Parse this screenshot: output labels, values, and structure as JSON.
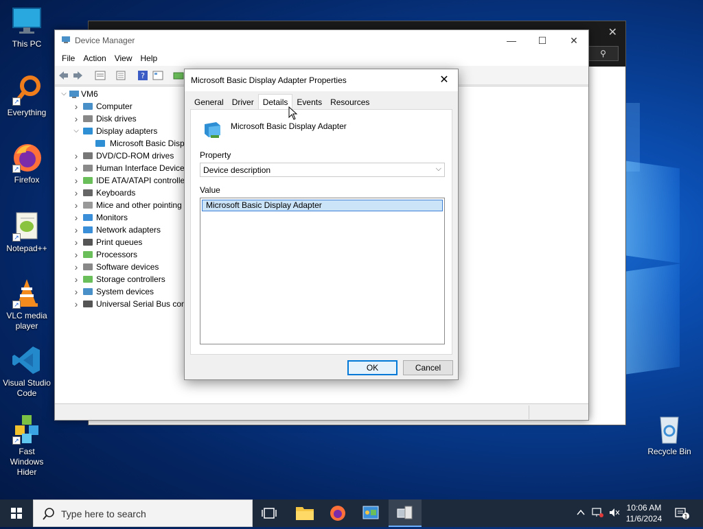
{
  "desktop": {
    "icons": [
      {
        "label": "This PC"
      },
      {
        "label": "Everything"
      },
      {
        "label": "Firefox"
      },
      {
        "label": "Notepad++"
      },
      {
        "label": "VLC media player"
      },
      {
        "label": "Visual Studio Code"
      },
      {
        "label": "Fast Windows Hider"
      }
    ],
    "recycle_bin": "Recycle Bin"
  },
  "device_manager": {
    "title": "Device Manager",
    "menu": [
      "File",
      "Action",
      "View",
      "Help"
    ],
    "tree": {
      "root": "VM6",
      "nodes": [
        {
          "label": "Computer",
          "expanded": false
        },
        {
          "label": "Disk drives",
          "expanded": false
        },
        {
          "label": "Display adapters",
          "expanded": true
        },
        {
          "label": "Microsoft Basic Disp",
          "child": true
        },
        {
          "label": "DVD/CD-ROM drives",
          "expanded": false
        },
        {
          "label": "Human Interface Device",
          "expanded": false
        },
        {
          "label": "IDE ATA/ATAPI controlle",
          "expanded": false
        },
        {
          "label": "Keyboards",
          "expanded": false
        },
        {
          "label": "Mice and other pointing",
          "expanded": false
        },
        {
          "label": "Monitors",
          "expanded": false
        },
        {
          "label": "Network adapters",
          "expanded": false
        },
        {
          "label": "Print queues",
          "expanded": false
        },
        {
          "label": "Processors",
          "expanded": false
        },
        {
          "label": "Software devices",
          "expanded": false
        },
        {
          "label": "Storage controllers",
          "expanded": false
        },
        {
          "label": "System devices",
          "expanded": false
        },
        {
          "label": "Universal Serial Bus cont",
          "expanded": false
        }
      ]
    }
  },
  "dialog": {
    "title": "Microsoft Basic Display Adapter Properties",
    "close_glyph": "✕",
    "tabs": [
      "General",
      "Driver",
      "Details",
      "Events",
      "Resources"
    ],
    "active_tab": "Details",
    "device_name": "Microsoft Basic Display Adapter",
    "property_label": "Property",
    "property_value": "Device description",
    "value_label": "Value",
    "value_items": [
      "Microsoft Basic Display Adapter"
    ],
    "ok_label": "OK",
    "cancel_label": "Cancel"
  },
  "taskbar": {
    "search_placeholder": "Type here to search",
    "time": "10:06 AM",
    "date": "11/6/2024",
    "notification_count": "1"
  }
}
